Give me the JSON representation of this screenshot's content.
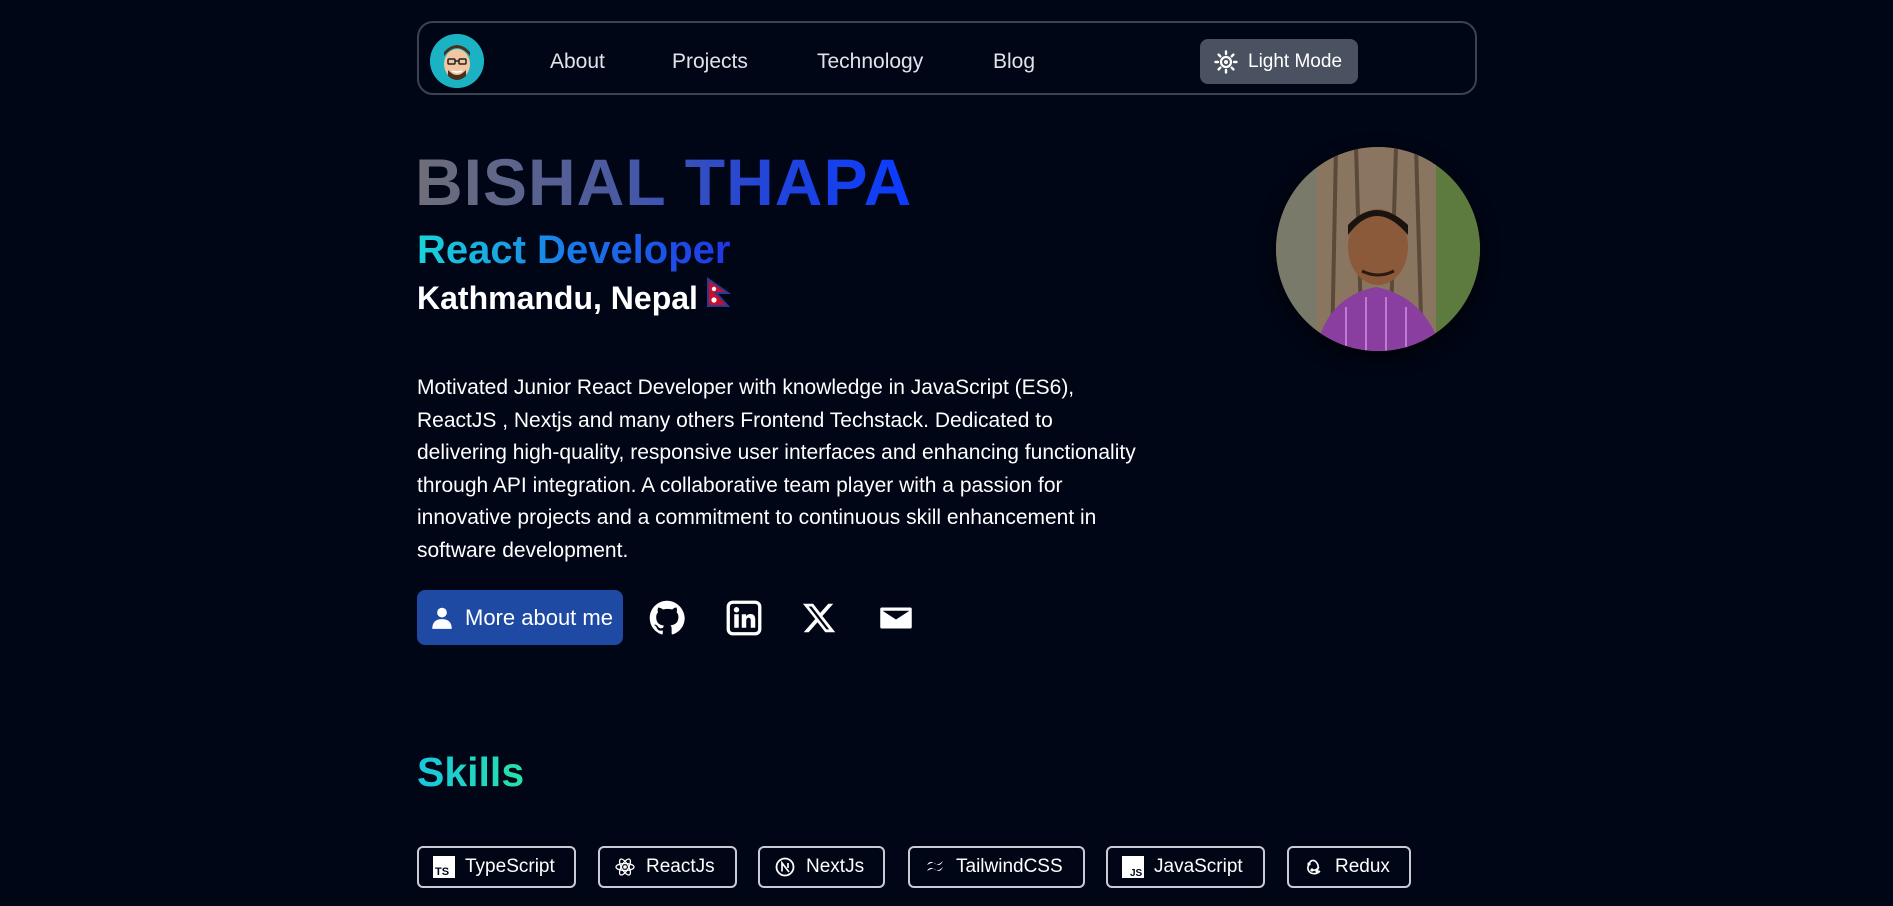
{
  "nav": {
    "links": [
      "About",
      "Projects",
      "Technology",
      "Blog"
    ],
    "theme_toggle_label": "Light Mode"
  },
  "hero": {
    "name": "BISHAL THAPA",
    "role": "React Developer",
    "location": "Kathmandu, Nepal",
    "bio": "Motivated Junior React Developer with knowledge in JavaScript (ES6), ReactJS , Nextjs and many others Frontend Techstack. Dedicated to delivering high-quality, responsive user interfaces and enhancing functionality through API integration. A collaborative team player with a passion for innovative projects and a commitment to continuous skill enhancement in software development.",
    "more_button_label": "More about me"
  },
  "social_icons": [
    "github-icon",
    "linkedin-icon",
    "x-icon",
    "mail-icon"
  ],
  "skills": {
    "title": "Skills",
    "items": [
      {
        "label": "TypeScript",
        "icon": "typescript-icon"
      },
      {
        "label": "ReactJs",
        "icon": "react-icon"
      },
      {
        "label": "NextJs",
        "icon": "nextjs-icon"
      },
      {
        "label": "TailwindCSS",
        "icon": "tailwind-icon"
      },
      {
        "label": "JavaScript",
        "icon": "javascript-icon"
      },
      {
        "label": "Redux",
        "icon": "redux-icon"
      }
    ]
  },
  "colors": {
    "background": "#010616",
    "nav_border": "#3b4250",
    "theme_button": "#4a5261",
    "primary_button": "#1e4aa3"
  }
}
